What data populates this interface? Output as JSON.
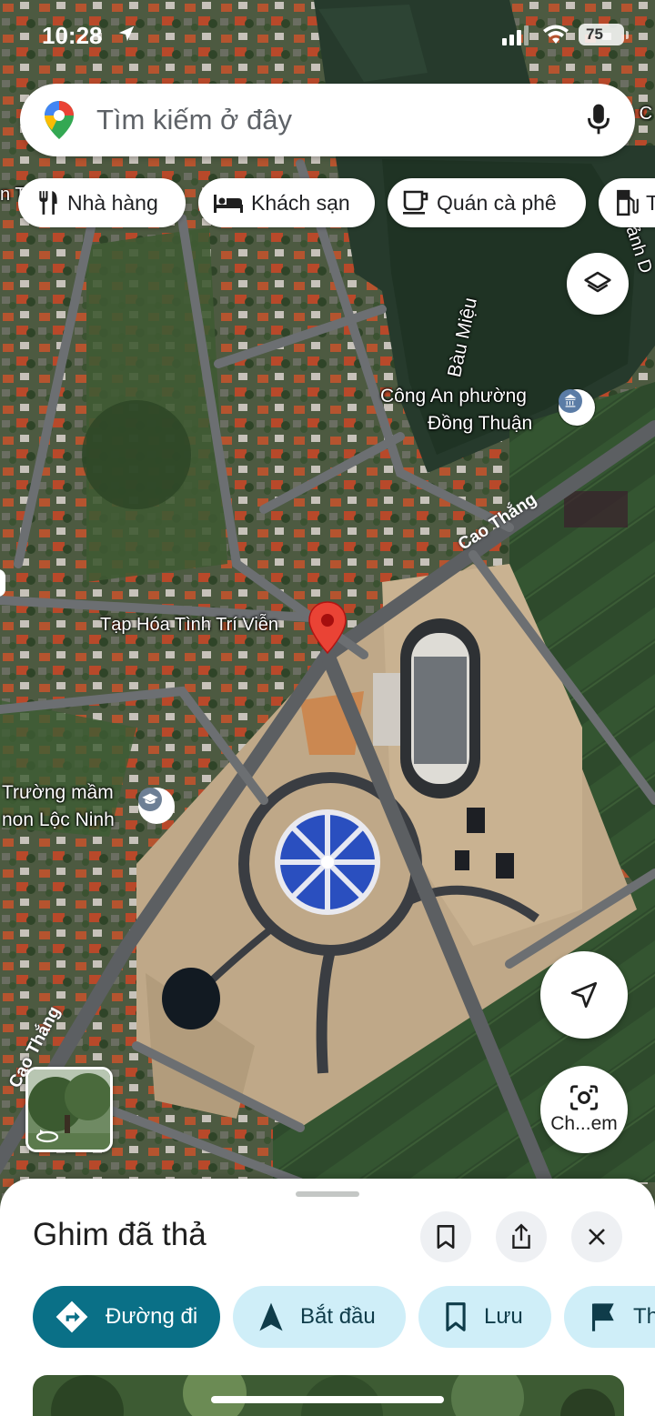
{
  "status_bar": {
    "time": "10:28",
    "battery": "75"
  },
  "search": {
    "placeholder": "Tìm kiếm ở đây"
  },
  "chips": [
    {
      "label": "Nhà hàng",
      "icon": "restaurant-icon"
    },
    {
      "label": "Khách sạn",
      "icon": "hotel-icon"
    },
    {
      "label": "Quán cà phê",
      "icon": "coffee-icon"
    },
    {
      "label": "T",
      "icon": "gas-station-icon"
    }
  ],
  "map": {
    "places": {
      "lake": "Bàu Miệu",
      "police": "Công An phường Đồng Thuận",
      "police_line1": "Công An phường",
      "police_line2": "Đồng Thuận",
      "shop": "Tạp Hóa Tình Trí Viễn",
      "school_line1": "Trường mầm",
      "school_line2": "non Lộc Ninh",
      "edge_left": "n T",
      "edge_right_top": "N",
      "edge_right_top2": "o C",
      "canh": "Cảnh D"
    },
    "roads": {
      "cao_thang_1": "Cao Thắng",
      "cao_thang_2": "Cao Thắng"
    },
    "camera_label": "Ch...em"
  },
  "sheet": {
    "title": "Ghim đã thả",
    "actions": [
      {
        "label": "Đường đi",
        "icon": "directions-icon"
      },
      {
        "label": "Bắt đầu",
        "icon": "navigation-icon"
      },
      {
        "label": "Lưu",
        "icon": "bookmark-icon"
      },
      {
        "label": "Th",
        "icon": "flag-icon"
      }
    ]
  },
  "colors": {
    "primary_action": "#0a7087",
    "secondary_action": "#cfeef8",
    "pin_red": "#ea4335"
  }
}
